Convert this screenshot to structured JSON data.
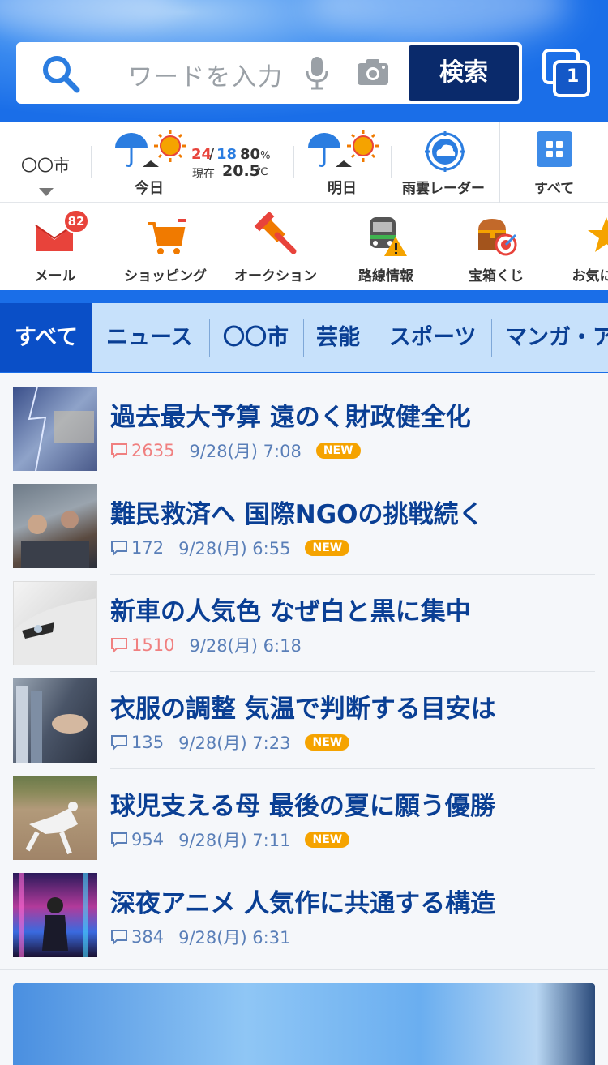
{
  "search": {
    "placeholder": "ワードを入力",
    "button_label": "検索",
    "tab_count": "1"
  },
  "weather": {
    "city": "〇〇市",
    "today_label": "今日",
    "high": "24",
    "separator": "/",
    "low": "18",
    "precip": "80",
    "precip_unit": "%",
    "now_label": "現在",
    "now_temp": "20.5",
    "now_unit": "℃",
    "tomorrow_label": "明日",
    "radar_label": "雨雲レーダー",
    "all_label": "すべて"
  },
  "services": [
    {
      "label": "メール",
      "icon": "mail-icon",
      "badge": "82"
    },
    {
      "label": "ショッピング",
      "icon": "cart-icon"
    },
    {
      "label": "オークション",
      "icon": "gavel-icon"
    },
    {
      "label": "路線情報",
      "icon": "train-alert-icon"
    },
    {
      "label": "宝箱くじ",
      "icon": "treasure-chest-icon"
    },
    {
      "label": "お気に入り",
      "icon": "star-icon"
    }
  ],
  "tabs": [
    {
      "label": "すべて",
      "active": true
    },
    {
      "label": "ニュース"
    },
    {
      "label": "〇〇市"
    },
    {
      "label": "芸能"
    },
    {
      "label": "スポーツ"
    },
    {
      "label": "マンガ・アニメ"
    }
  ],
  "news": [
    {
      "title": "過去最大予算 遠のく財政健全化",
      "comments": "2635",
      "hot": true,
      "date": "9/28(月) 7:08",
      "new": "NEW"
    },
    {
      "title": "難民救済へ 国際NGOの挑戦続く",
      "comments": "172",
      "hot": false,
      "date": "9/28(月) 6:55",
      "new": "NEW"
    },
    {
      "title": "新車の人気色 なぜ白と黒に集中",
      "comments": "1510",
      "hot": true,
      "date": "9/28(月) 6:18",
      "new": ""
    },
    {
      "title": "衣服の調整 気温で判断する目安は",
      "comments": "135",
      "hot": false,
      "date": "9/28(月) 7:23",
      "new": "NEW"
    },
    {
      "title": "球児支える母 最後の夏に願う優勝",
      "comments": "954",
      "hot": false,
      "date": "9/28(月) 7:11",
      "new": "NEW"
    },
    {
      "title": "深夜アニメ 人気作に共通する構造",
      "comments": "384",
      "hot": false,
      "date": "9/28(月) 6:31",
      "new": ""
    }
  ],
  "colors": {
    "brand": "#1a6ee8",
    "search_button": "#0a2a6b",
    "title": "#0a3f94",
    "hot": "#f08080",
    "new": "#f5a300"
  }
}
